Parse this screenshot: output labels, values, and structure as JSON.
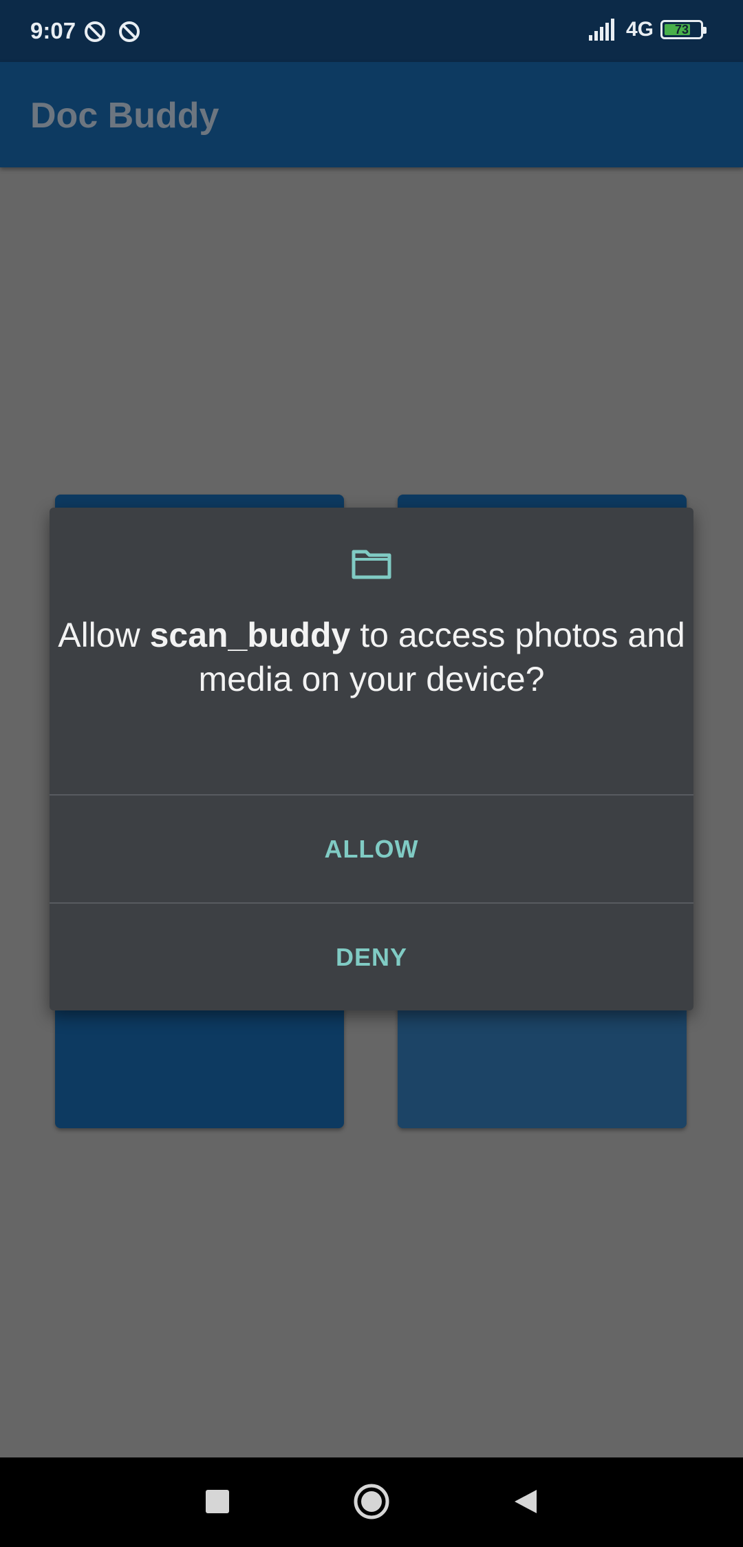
{
  "status_bar": {
    "time": "9:07",
    "network": "4G",
    "battery_level": "73",
    "battery_percent": 73,
    "icons": [
      "dnd-icon",
      "dnd-icon",
      "signal-icon",
      "battery-icon"
    ]
  },
  "app_bar": {
    "title": "Doc Buddy"
  },
  "dialog": {
    "icon": "folder-icon",
    "message_prefix": "Allow ",
    "app_name": "scan_buddy",
    "message_suffix": " to access photos and media on your device?",
    "allow_label": "ALLOW",
    "deny_label": "DENY"
  },
  "navigation": {
    "buttons": [
      "recents-square-icon",
      "home-circle-icon",
      "back-triangle-icon"
    ]
  },
  "colors": {
    "status_bar": "#0c2a48",
    "app_bar": "#0d3a61",
    "scrim": "#666666",
    "dialog": "#3d4044",
    "accent": "#80cbc4",
    "battery": "#49b04b"
  }
}
